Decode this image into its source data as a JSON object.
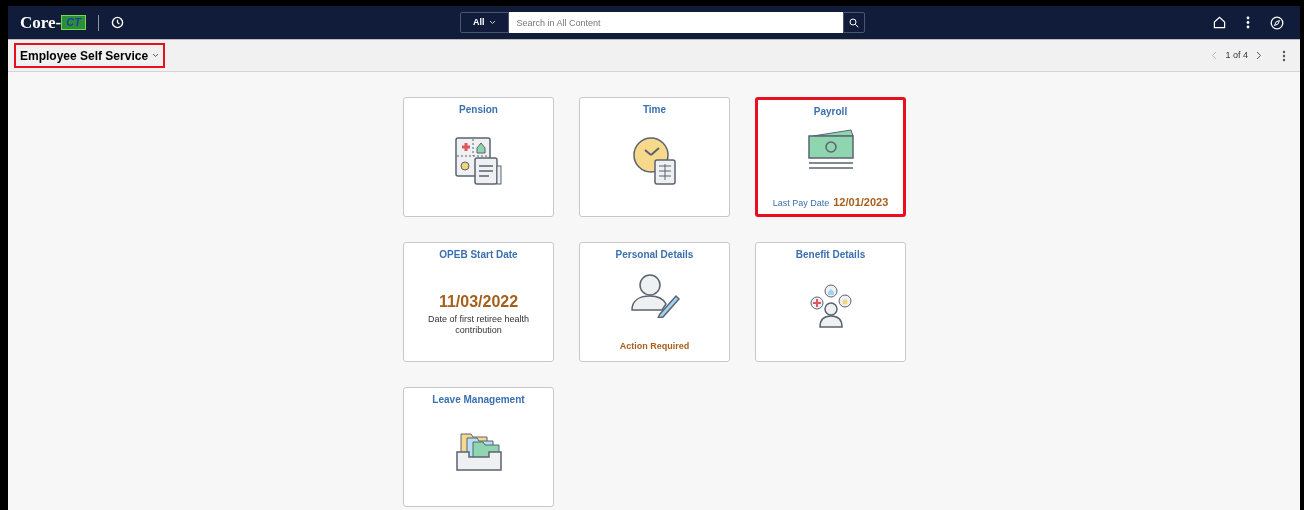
{
  "header": {
    "logo_text": "Core-",
    "logo_badge": "CT",
    "search_scope": "All",
    "search": {
      "placeholder": "Search in All Content"
    }
  },
  "page_bar": {
    "title": "Employee Self Service",
    "highlighted": true,
    "pager": "1 of 4"
  },
  "tiles": [
    {
      "kind": "pension",
      "title": "Pension",
      "highlighted": false
    },
    {
      "kind": "time",
      "title": "Time",
      "highlighted": false
    },
    {
      "kind": "payroll",
      "title": "Payroll",
      "highlighted": true,
      "footer_label": "Last Pay Date",
      "footer_value": "12/01/2023"
    },
    {
      "kind": "date",
      "title": "OPEB Start Date",
      "highlighted": false,
      "date": "11/03/2022",
      "description": "Date of first retiree health contribution"
    },
    {
      "kind": "personal",
      "title": "Personal Details",
      "highlighted": false,
      "status": "Action Required"
    },
    {
      "kind": "benefits",
      "title": "Benefit Details",
      "highlighted": false
    },
    {
      "kind": "leave",
      "title": "Leave Management",
      "highlighted": false
    }
  ]
}
